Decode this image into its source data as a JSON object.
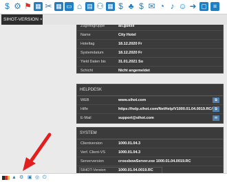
{
  "tab": {
    "label": "SIHOT-VERSION",
    "close": "×"
  },
  "toolbar": {
    "icons": [
      "dollar-icon",
      "settings-icon",
      "flag-icon",
      "calendar-icon",
      "tools-icon",
      "calendar-icon",
      "cash-icon",
      "home-icon",
      "chart-icon",
      "group-icon",
      "table-icon",
      "dollar-icon",
      "clean-icon",
      "dollar-icon",
      "bag-icon",
      "gauge-icon",
      "bell-icon",
      "user-icon",
      "exit-icon",
      "window-icon",
      "list-icon"
    ]
  },
  "general": {
    "rows": [
      {
        "label": "Zugriffsgruppe",
        "value": "all.gukse"
      },
      {
        "label": "Name",
        "value": "City Hotel"
      },
      {
        "label": "Hoteltag",
        "value": "18.12.2020 Fr"
      },
      {
        "label": "Systemdatum",
        "value": "18.12.2020 Fr"
      },
      {
        "label": "Yield Daten bis",
        "value": "31.01.2021 So"
      },
      {
        "label": "Schicht",
        "value": "Nicht angemeldet"
      }
    ]
  },
  "helpdesk": {
    "title": "HELPDESK",
    "rows": [
      {
        "label": "WEB",
        "value": "www.sihot.com"
      },
      {
        "label": "Hilfe",
        "value": "https://help.sihot.com/NetHelp/V1000.01.04.0019.RC/"
      },
      {
        "label": "E-Mail",
        "value": "support@sihot.com"
      }
    ]
  },
  "system": {
    "title": "SYSTEM",
    "rows": [
      {
        "label": "Clientversion",
        "value": "1000.01.04.3"
      },
      {
        "label": "Verf. Client-VS",
        "value": "1000.01.04.3"
      },
      {
        "label": "Serverversion",
        "value": "crossbowServer.exe 1000.01.04.0019.RC"
      },
      {
        "label": "SIHOT-Version",
        "value": "1000.01.04.0019.RC"
      }
    ]
  },
  "colors": {
    "toolbar_icon": "#1e7fc4",
    "highlight": "#e21f1f",
    "panel_bg": "#3b3b3b"
  }
}
